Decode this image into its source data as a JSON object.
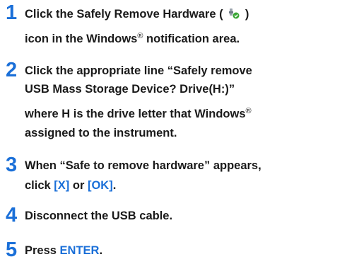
{
  "steps": [
    {
      "number": "1",
      "line1_a": "Click the Safely Remove Hardware (",
      "icon": "safely-remove-hardware-icon",
      "line1_b": ")",
      "line2_a": "icon in the Windows",
      "line2_sup": "®",
      "line2_b": " notification area."
    },
    {
      "number": "2",
      "line1": "Click the appropriate line “Safely remove",
      "line2": "USB Mass Storage Device? Drive(H:)”",
      "line3_a": "where H is the drive letter that Windows",
      "line3_sup": "®",
      "line4": "assigned to the instrument."
    },
    {
      "number": "3",
      "line1": "When “Safe to remove hardware” appears,",
      "line2_a": "click ",
      "x_key": "[X]",
      "line2_or": " or ",
      "ok_key": "[OK]",
      "line2_end": "."
    },
    {
      "number": "4",
      "line1": "Disconnect the USB cable."
    },
    {
      "number": "5",
      "line1_a": "Press ",
      "enter_key": "ENTER",
      "line1_end": "."
    }
  ],
  "colors": {
    "step_number": "#1a6fd8",
    "key_text": "#1a6fd8",
    "body_text": "#1a1a1a"
  }
}
